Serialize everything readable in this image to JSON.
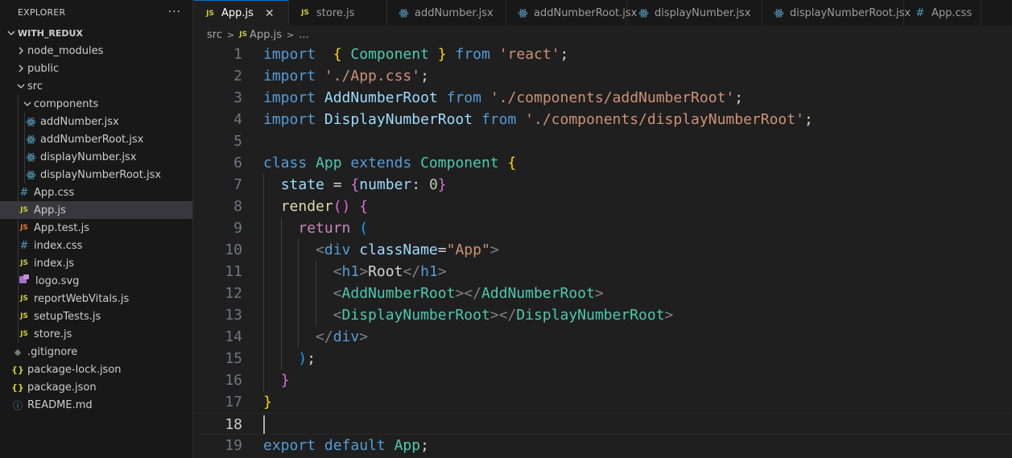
{
  "explorer": {
    "title": "EXPLORER",
    "more": "···",
    "root": "WITH_REDUX",
    "items": [
      {
        "label": "node_modules",
        "icon": "chevron-right-icon"
      },
      {
        "label": "public",
        "icon": "chevron-right-icon"
      },
      {
        "label": "src",
        "icon": "chevron-down-icon"
      },
      {
        "label": "components",
        "icon": "chevron-down-icon"
      },
      {
        "label": "addNumber.jsx",
        "icon": "react-icon"
      },
      {
        "label": "addNumberRoot.jsx",
        "icon": "react-icon"
      },
      {
        "label": "displayNumber.jsx",
        "icon": "react-icon"
      },
      {
        "label": "displayNumberRoot.jsx",
        "icon": "react-icon"
      },
      {
        "label": "App.css",
        "icon": "css-icon",
        "glyph": "#"
      },
      {
        "label": "App.js",
        "icon": "js-icon",
        "glyph": "JS"
      },
      {
        "label": "App.test.js",
        "icon": "test-js-icon",
        "glyph": "JS"
      },
      {
        "label": "index.css",
        "icon": "css-icon",
        "glyph": "#"
      },
      {
        "label": "index.js",
        "icon": "js-icon",
        "glyph": "JS"
      },
      {
        "label": "logo.svg",
        "icon": "svg-icon"
      },
      {
        "label": "reportWebVitals.js",
        "icon": "js-icon",
        "glyph": "JS"
      },
      {
        "label": "setupTests.js",
        "icon": "js-icon",
        "glyph": "JS"
      },
      {
        "label": "store.js",
        "icon": "js-icon",
        "glyph": "JS"
      },
      {
        "label": ".gitignore",
        "icon": "git-icon",
        "glyph": "◆"
      },
      {
        "label": "package-lock.json",
        "icon": "json-icon",
        "glyph": "{}"
      },
      {
        "label": "package.json",
        "icon": "json-icon",
        "glyph": "{}"
      },
      {
        "label": "README.md",
        "icon": "info-icon",
        "glyph": "ⓘ"
      }
    ]
  },
  "tabs": [
    {
      "label": "App.js",
      "glyph": "JS",
      "close": "✕"
    },
    {
      "label": "store.js",
      "glyph": "JS"
    },
    {
      "label": "addNumber.jsx"
    },
    {
      "label": "addNumberRoot.jsx"
    },
    {
      "label": "displayNumber.jsx"
    },
    {
      "label": "displayNumberRoot.jsx"
    },
    {
      "label": "App.css",
      "glyph": "#"
    }
  ],
  "breadcrumb": {
    "folder": "src",
    "sep": ">",
    "glyph": "JS",
    "file": "App.js",
    "more": "..."
  },
  "editor": {
    "current_line": 18,
    "lines": [
      {
        "n": "1",
        "tokens": [
          [
            "kw",
            "import"
          ],
          [
            "",
            "  "
          ],
          [
            "b1",
            "{"
          ],
          [
            "",
            " "
          ],
          [
            "cls",
            "Component"
          ],
          [
            "",
            " "
          ],
          [
            "b1",
            "}"
          ],
          [
            "",
            " "
          ],
          [
            "kw",
            "from"
          ],
          [
            "",
            " "
          ],
          [
            "str",
            "'react'"
          ],
          [
            "",
            ";"
          ]
        ]
      },
      {
        "n": "2",
        "tokens": [
          [
            "kw",
            "import"
          ],
          [
            "",
            " "
          ],
          [
            "str",
            "'./App.css'"
          ],
          [
            "",
            ";"
          ]
        ]
      },
      {
        "n": "3",
        "tokens": [
          [
            "kw",
            "import"
          ],
          [
            "",
            " "
          ],
          [
            "var",
            "AddNumberRoot"
          ],
          [
            "",
            " "
          ],
          [
            "kw",
            "from"
          ],
          [
            "",
            " "
          ],
          [
            "str",
            "'./components/addNumberRoot'"
          ],
          [
            "",
            ";"
          ]
        ]
      },
      {
        "n": "4",
        "tokens": [
          [
            "kw",
            "import"
          ],
          [
            "",
            " "
          ],
          [
            "var",
            "DisplayNumberRoot"
          ],
          [
            "",
            " "
          ],
          [
            "kw",
            "from"
          ],
          [
            "",
            " "
          ],
          [
            "str",
            "'./components/displayNumberRoot'"
          ],
          [
            "",
            ";"
          ]
        ]
      },
      {
        "n": "5",
        "tokens": []
      },
      {
        "n": "6",
        "tokens": [
          [
            "kw",
            "class"
          ],
          [
            "",
            " "
          ],
          [
            "cls",
            "App"
          ],
          [
            "",
            " "
          ],
          [
            "kw",
            "extends"
          ],
          [
            "",
            " "
          ],
          [
            "cls",
            "Component"
          ],
          [
            "",
            " "
          ],
          [
            "b1",
            "{"
          ]
        ]
      },
      {
        "n": "7",
        "tokens": [
          [
            "",
            "  "
          ],
          [
            "var",
            "state"
          ],
          [
            "",
            " = "
          ],
          [
            "b2",
            "{"
          ],
          [
            "var",
            "number"
          ],
          [
            "",
            ": "
          ],
          [
            "num",
            "0"
          ],
          [
            "b2",
            "}"
          ]
        ]
      },
      {
        "n": "8",
        "tokens": [
          [
            "",
            "  "
          ],
          [
            "fn",
            "render"
          ],
          [
            "b2",
            "()"
          ],
          [
            "",
            " "
          ],
          [
            "b2",
            "{"
          ]
        ]
      },
      {
        "n": "9",
        "tokens": [
          [
            "",
            "    "
          ],
          [
            "ctl",
            "return"
          ],
          [
            "",
            " "
          ],
          [
            "b3",
            "("
          ]
        ]
      },
      {
        "n": "10",
        "tokens": [
          [
            "",
            "      "
          ],
          [
            "punct",
            "<"
          ],
          [
            "tag",
            "div"
          ],
          [
            "",
            " "
          ],
          [
            "var",
            "className"
          ],
          [
            "",
            "="
          ],
          [
            "str",
            "\"App\""
          ],
          [
            "punct",
            ">"
          ]
        ]
      },
      {
        "n": "11",
        "tokens": [
          [
            "",
            "        "
          ],
          [
            "punct",
            "<"
          ],
          [
            "tag",
            "h1"
          ],
          [
            "punct",
            ">"
          ],
          [
            "",
            "Root"
          ],
          [
            "punct",
            "</"
          ],
          [
            "tag",
            "h1"
          ],
          [
            "punct",
            ">"
          ]
        ]
      },
      {
        "n": "12",
        "tokens": [
          [
            "",
            "        "
          ],
          [
            "punct",
            "<"
          ],
          [
            "cls",
            "AddNumberRoot"
          ],
          [
            "punct",
            "></"
          ],
          [
            "cls",
            "AddNumberRoot"
          ],
          [
            "punct",
            ">"
          ]
        ]
      },
      {
        "n": "13",
        "tokens": [
          [
            "",
            "        "
          ],
          [
            "punct",
            "<"
          ],
          [
            "cls",
            "DisplayNumberRoot"
          ],
          [
            "punct",
            "></"
          ],
          [
            "cls",
            "DisplayNumberRoot"
          ],
          [
            "punct",
            ">"
          ]
        ]
      },
      {
        "n": "14",
        "tokens": [
          [
            "",
            "      "
          ],
          [
            "punct",
            "</"
          ],
          [
            "tag",
            "div"
          ],
          [
            "punct",
            ">"
          ]
        ]
      },
      {
        "n": "15",
        "tokens": [
          [
            "",
            "    "
          ],
          [
            "b3",
            ")"
          ],
          [
            "",
            ";"
          ]
        ]
      },
      {
        "n": "16",
        "tokens": [
          [
            "",
            "  "
          ],
          [
            "b2",
            "}"
          ]
        ]
      },
      {
        "n": "17",
        "tokens": [
          [
            "b1",
            "}"
          ]
        ]
      },
      {
        "n": "18",
        "tokens": []
      },
      {
        "n": "19",
        "tokens": [
          [
            "kw",
            "export"
          ],
          [
            "",
            " "
          ],
          [
            "kw",
            "default"
          ],
          [
            "",
            " "
          ],
          [
            "cls",
            "App"
          ],
          [
            "",
            ";"
          ]
        ]
      }
    ]
  },
  "colors": {
    "accent": "#0078d4",
    "sidebar_bg": "#181818",
    "editor_bg": "#1f1f1f",
    "selected_row": "#37373d"
  }
}
